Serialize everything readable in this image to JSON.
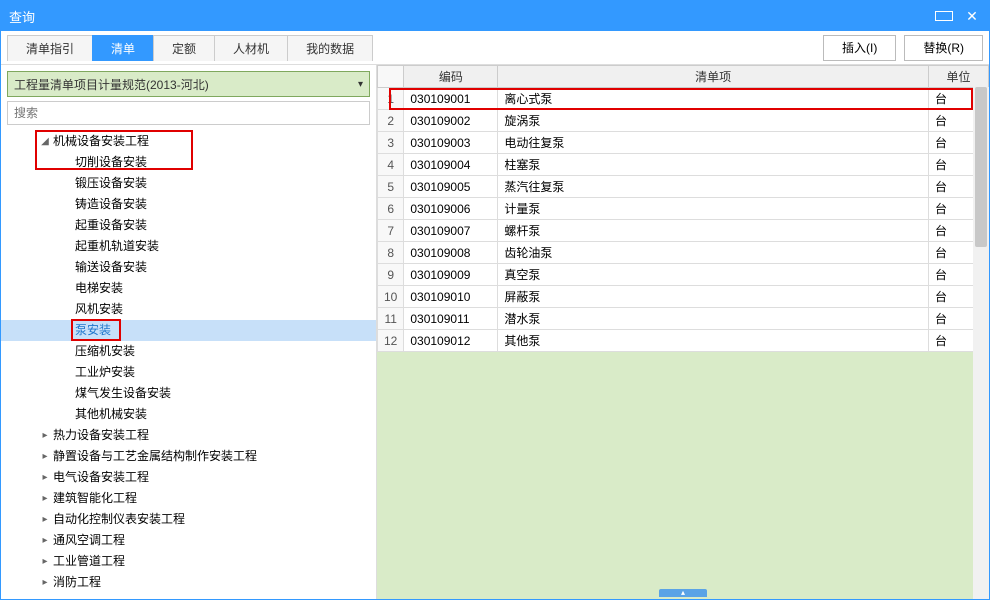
{
  "window": {
    "title": "查询"
  },
  "tabs": {
    "items": [
      {
        "label": "清单指引"
      },
      {
        "label": "清单"
      },
      {
        "label": "定额"
      },
      {
        "label": "人材机"
      },
      {
        "label": "我的数据"
      }
    ],
    "active_index": 1
  },
  "buttons": {
    "insert": "插入(I)",
    "replace": "替换(R)"
  },
  "combo": {
    "label": "工程量清单项目计量规范(2013-河北)"
  },
  "search": {
    "placeholder": "搜索"
  },
  "tree": {
    "root": {
      "label": "机械设备安装工程"
    },
    "children": [
      {
        "label": "切削设备安装"
      },
      {
        "label": "锻压设备安装"
      },
      {
        "label": "铸造设备安装"
      },
      {
        "label": "起重设备安装"
      },
      {
        "label": "起重机轨道安装"
      },
      {
        "label": "输送设备安装"
      },
      {
        "label": "电梯安装"
      },
      {
        "label": "风机安装"
      },
      {
        "label": "泵安装"
      },
      {
        "label": "压缩机安装"
      },
      {
        "label": "工业炉安装"
      },
      {
        "label": "煤气发生设备安装"
      },
      {
        "label": "其他机械安装"
      }
    ],
    "siblings": [
      {
        "label": "热力设备安装工程"
      },
      {
        "label": "静置设备与工艺金属结构制作安装工程"
      },
      {
        "label": "电气设备安装工程"
      },
      {
        "label": "建筑智能化工程"
      },
      {
        "label": "自动化控制仪表安装工程"
      },
      {
        "label": "通风空调工程"
      },
      {
        "label": "工业管道工程"
      },
      {
        "label": "消防工程"
      }
    ]
  },
  "grid": {
    "headers": {
      "code": "编码",
      "item": "清单项",
      "unit": "单位"
    },
    "rows": [
      {
        "n": "1",
        "code": "030109001",
        "item": "离心式泵",
        "unit": "台"
      },
      {
        "n": "2",
        "code": "030109002",
        "item": "旋涡泵",
        "unit": "台"
      },
      {
        "n": "3",
        "code": "030109003",
        "item": "电动往复泵",
        "unit": "台"
      },
      {
        "n": "4",
        "code": "030109004",
        "item": "柱塞泵",
        "unit": "台"
      },
      {
        "n": "5",
        "code": "030109005",
        "item": "蒸汽往复泵",
        "unit": "台"
      },
      {
        "n": "6",
        "code": "030109006",
        "item": "计量泵",
        "unit": "台"
      },
      {
        "n": "7",
        "code": "030109007",
        "item": "螺杆泵",
        "unit": "台"
      },
      {
        "n": "8",
        "code": "030109008",
        "item": "齿轮油泵",
        "unit": "台"
      },
      {
        "n": "9",
        "code": "030109009",
        "item": "真空泵",
        "unit": "台"
      },
      {
        "n": "10",
        "code": "030109010",
        "item": "屏蔽泵",
        "unit": "台"
      },
      {
        "n": "11",
        "code": "030109011",
        "item": "潜水泵",
        "unit": "台"
      },
      {
        "n": "12",
        "code": "030109012",
        "item": "其他泵",
        "unit": "台"
      }
    ]
  }
}
